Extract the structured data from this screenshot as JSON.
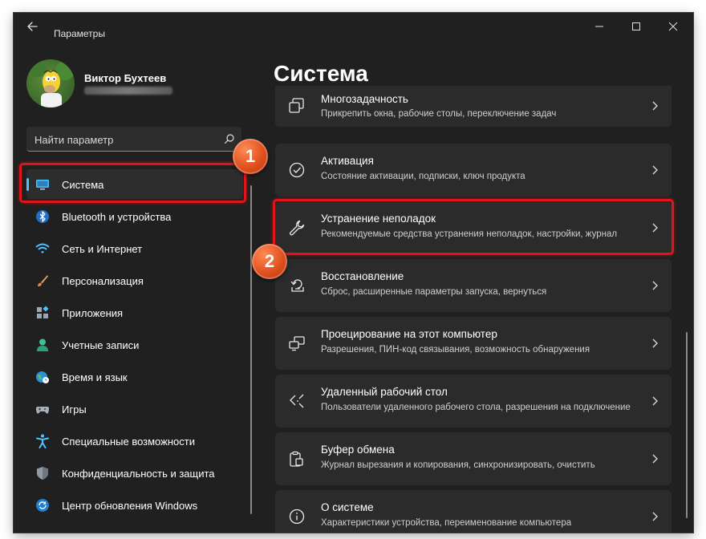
{
  "window": {
    "title": "Параметры"
  },
  "profile": {
    "name": "Виктор Бухтеев"
  },
  "search": {
    "placeholder": "Найти параметр"
  },
  "nav": {
    "items": [
      {
        "label": "Система",
        "icon": "monitor-icon",
        "selected": true
      },
      {
        "label": "Bluetooth и устройства",
        "icon": "bluetooth-icon"
      },
      {
        "label": "Сеть и Интернет",
        "icon": "wifi-icon"
      },
      {
        "label": "Персонализация",
        "icon": "brush-icon"
      },
      {
        "label": "Приложения",
        "icon": "apps-icon"
      },
      {
        "label": "Учетные записи",
        "icon": "person-icon"
      },
      {
        "label": "Время и язык",
        "icon": "globe-clock-icon"
      },
      {
        "label": "Игры",
        "icon": "gamepad-icon"
      },
      {
        "label": "Специальные возможности",
        "icon": "accessibility-icon"
      },
      {
        "label": "Конфиденциальность и защита",
        "icon": "shield-icon"
      },
      {
        "label": "Центр обновления Windows",
        "icon": "update-icon"
      }
    ]
  },
  "main": {
    "title": "Система",
    "cards": [
      {
        "title": "Многозадачность",
        "subtitle": "Прикрепить окна, рабочие столы, переключение задач",
        "icon": "multitasking-icon"
      },
      {
        "title": "Активация",
        "subtitle": "Состояние активации, подписки, ключ продукта",
        "icon": "check-circle-icon"
      },
      {
        "title": "Устранение неполадок",
        "subtitle": "Рекомендуемые средства устранения неполадок, настройки, журнал",
        "icon": "wrench-icon"
      },
      {
        "title": "Восстановление",
        "subtitle": "Сброс, расширенные параметры запуска, вернуться",
        "icon": "recovery-icon"
      },
      {
        "title": "Проецирование на этот компьютер",
        "subtitle": "Разрешения, ПИН-код связывания, возможность обнаружения",
        "icon": "projection-icon"
      },
      {
        "title": "Удаленный рабочий стол",
        "subtitle": "Пользователи удаленного рабочего стола, разрешения на подключение",
        "icon": "remote-desktop-icon"
      },
      {
        "title": "Буфер обмена",
        "subtitle": "Журнал вырезания и копирования, синхронизировать, очистить",
        "icon": "clipboard-icon"
      },
      {
        "title": "О системе",
        "subtitle": "Характеристики устройства, переименование компьютера",
        "icon": "info-icon"
      }
    ]
  },
  "annotations": {
    "step1": "1",
    "step2": "2"
  },
  "colors": {
    "window_bg": "#202020",
    "card_bg": "#2b2b2b",
    "accent": "#4cc2ff",
    "highlight": "#e0141b",
    "badge": "#e0501e"
  }
}
